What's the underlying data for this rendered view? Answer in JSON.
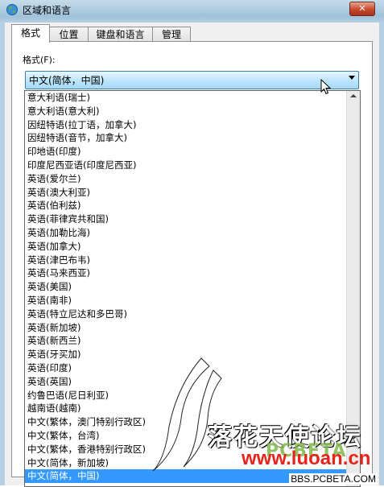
{
  "window": {
    "title": "区域和语言",
    "close_glyph": "✕"
  },
  "tabs": [
    {
      "label": "格式",
      "active": true
    },
    {
      "label": "位置",
      "active": false
    },
    {
      "label": "键盘和语言",
      "active": false
    },
    {
      "label": "管理",
      "active": false
    }
  ],
  "format": {
    "label": "格式(F):",
    "selected_value": "中文(简体，中国)"
  },
  "dropdown": {
    "items": [
      "意大利语(瑞士)",
      "意大利语(意大利)",
      "因纽特语(拉丁语，加拿大)",
      "因纽特语(音节，加拿大)",
      "印地语(印度)",
      "印度尼西亚语(印度尼西亚)",
      "英语(爱尔兰)",
      "英语(澳大利亚)",
      "英语(伯利兹)",
      "英语(菲律宾共和国)",
      "英语(加勒比海)",
      "英语(加拿大)",
      "英语(津巴布韦)",
      "英语(马来西亚)",
      "英语(美国)",
      "英语(南非)",
      "英语(特立尼达和多巴哥)",
      "英语(新加坡)",
      "英语(新西兰)",
      "英语(牙买加)",
      "英语(印度)",
      "英语(英国)",
      "约鲁巴语(尼日利亚)",
      "越南语(越南)",
      "中文(繁体，澳门特别行政区)",
      "中文(繁体，台湾)",
      "中文(繁体，香港特别行政区)",
      "中文(简体，新加坡)",
      "中文(简体，中国)"
    ],
    "selected_index": 28
  },
  "watermark": {
    "forum_name": "落花天使论坛",
    "pcbeta": "PCBETA",
    "url": "www.luoan.cn",
    "bbs": "BBS.PCBETA.COM"
  }
}
